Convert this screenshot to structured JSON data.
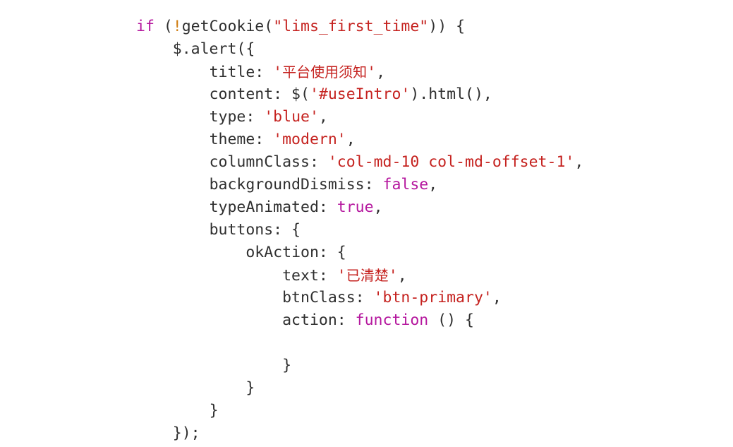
{
  "document": {
    "kind": "code-snippet",
    "language": "javascript",
    "background_color": "#ffffff",
    "colors": {
      "plain": "#2f2f2f",
      "keyword": "#b5179e",
      "string": "#c5221f",
      "operator": "#d07d12"
    },
    "lines": [
      {
        "indent": 0,
        "tokens": [
          {
            "t": "if",
            "c": "keyword"
          },
          {
            "t": " (",
            "c": "plain"
          },
          {
            "t": "!",
            "c": "operator"
          },
          {
            "t": "getCookie(",
            "c": "plain"
          },
          {
            "t": "\"lims_first_time\"",
            "c": "string"
          },
          {
            "t": ")) {",
            "c": "plain"
          }
        ]
      },
      {
        "indent": 4,
        "tokens": [
          {
            "t": "$.alert({",
            "c": "plain"
          }
        ]
      },
      {
        "indent": 8,
        "tokens": [
          {
            "t": "title: ",
            "c": "plain"
          },
          {
            "t": "'",
            "c": "string"
          },
          {
            "t": "平台使用须知",
            "c": "cjk"
          },
          {
            "t": "'",
            "c": "string"
          },
          {
            "t": ",",
            "c": "plain"
          }
        ]
      },
      {
        "indent": 8,
        "tokens": [
          {
            "t": "content: $(",
            "c": "plain"
          },
          {
            "t": "'#useIntro'",
            "c": "string"
          },
          {
            "t": ").html(),",
            "c": "plain"
          }
        ]
      },
      {
        "indent": 8,
        "tokens": [
          {
            "t": "type: ",
            "c": "plain"
          },
          {
            "t": "'blue'",
            "c": "string"
          },
          {
            "t": ",",
            "c": "plain"
          }
        ]
      },
      {
        "indent": 8,
        "tokens": [
          {
            "t": "theme: ",
            "c": "plain"
          },
          {
            "t": "'modern'",
            "c": "string"
          },
          {
            "t": ",",
            "c": "plain"
          }
        ]
      },
      {
        "indent": 8,
        "tokens": [
          {
            "t": "columnClass: ",
            "c": "plain"
          },
          {
            "t": "'col-md-10 col-md-offset-1'",
            "c": "string"
          },
          {
            "t": ",",
            "c": "plain"
          }
        ]
      },
      {
        "indent": 8,
        "tokens": [
          {
            "t": "backgroundDismiss: ",
            "c": "plain"
          },
          {
            "t": "false",
            "c": "keyword"
          },
          {
            "t": ",",
            "c": "plain"
          }
        ]
      },
      {
        "indent": 8,
        "tokens": [
          {
            "t": "typeAnimated: ",
            "c": "plain"
          },
          {
            "t": "true",
            "c": "keyword"
          },
          {
            "t": ",",
            "c": "plain"
          }
        ]
      },
      {
        "indent": 8,
        "tokens": [
          {
            "t": "buttons: {",
            "c": "plain"
          }
        ]
      },
      {
        "indent": 12,
        "tokens": [
          {
            "t": "okAction: {",
            "c": "plain"
          }
        ]
      },
      {
        "indent": 16,
        "tokens": [
          {
            "t": "text: ",
            "c": "plain"
          },
          {
            "t": "'",
            "c": "string"
          },
          {
            "t": "已清楚",
            "c": "cjk"
          },
          {
            "t": "'",
            "c": "string"
          },
          {
            "t": ",",
            "c": "plain"
          }
        ]
      },
      {
        "indent": 16,
        "tokens": [
          {
            "t": "btnClass: ",
            "c": "plain"
          },
          {
            "t": "'btn-primary'",
            "c": "string"
          },
          {
            "t": ",",
            "c": "plain"
          }
        ]
      },
      {
        "indent": 16,
        "tokens": [
          {
            "t": "action: ",
            "c": "plain"
          },
          {
            "t": "function",
            "c": "keyword"
          },
          {
            "t": " () {",
            "c": "plain"
          }
        ]
      },
      {
        "indent": 0,
        "tokens": []
      },
      {
        "indent": 16,
        "tokens": [
          {
            "t": "}",
            "c": "plain"
          }
        ]
      },
      {
        "indent": 12,
        "tokens": [
          {
            "t": "}",
            "c": "plain"
          }
        ]
      },
      {
        "indent": 8,
        "tokens": [
          {
            "t": "}",
            "c": "plain"
          }
        ]
      },
      {
        "indent": 4,
        "tokens": [
          {
            "t": "});",
            "c": "plain"
          }
        ]
      }
    ]
  }
}
